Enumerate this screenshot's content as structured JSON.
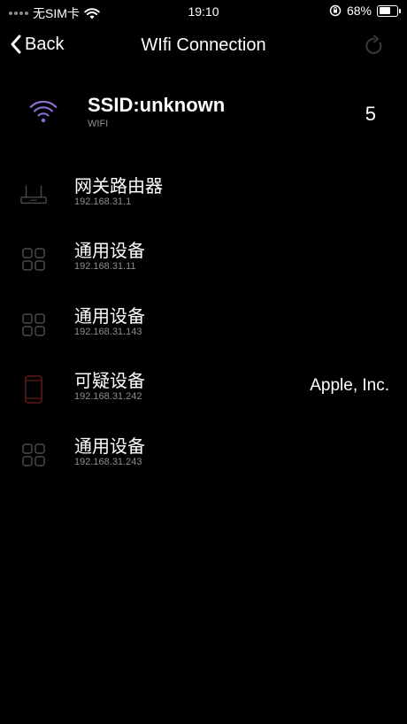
{
  "status_bar": {
    "carrier": "无SIM卡",
    "time": "19:10",
    "battery": "68%",
    "battery_level": 0.68
  },
  "nav": {
    "back_label": "Back",
    "title": "WIfi Connection"
  },
  "wifi": {
    "ssid": "SSID:unknown",
    "type": "WIFI",
    "device_count": "5"
  },
  "devices": [
    {
      "name": "网关路由器",
      "ip": "192.168.31.1",
      "vendor": "",
      "icon": "router-icon"
    },
    {
      "name": "通用设备",
      "ip": "192.168.31.11",
      "vendor": "",
      "icon": "grid-device-icon"
    },
    {
      "name": "通用设备",
      "ip": "192.168.31.143",
      "vendor": "",
      "icon": "grid-device-icon"
    },
    {
      "name": "可疑设备",
      "ip": "192.168.31.242",
      "vendor": "Apple, Inc.",
      "icon": "phone-icon"
    },
    {
      "name": "通用设备",
      "ip": "192.168.31.243",
      "vendor": "",
      "icon": "grid-device-icon"
    }
  ],
  "colors": {
    "background": "#000000",
    "secondary_text": "#8d8d8d",
    "wifi_icon": "#8a6fd1",
    "suspicious_icon": "#5a1a1a"
  }
}
